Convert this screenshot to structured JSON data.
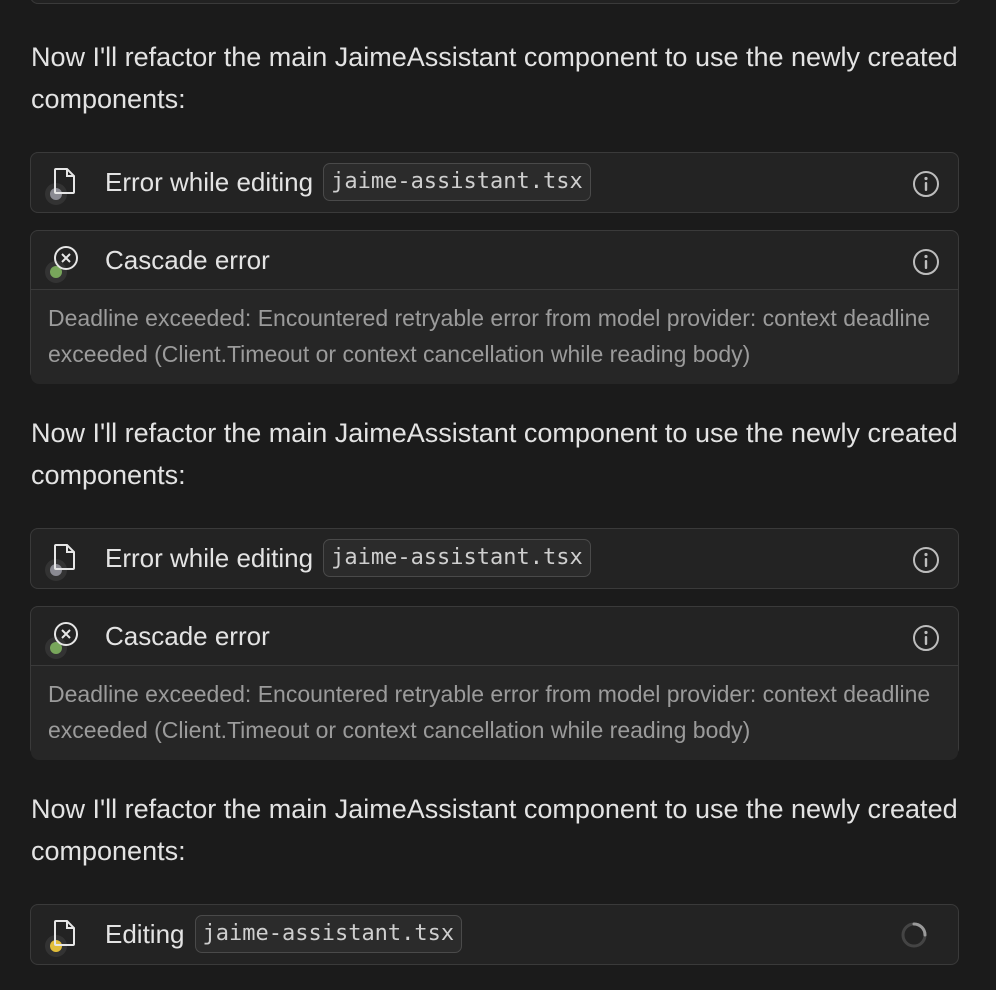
{
  "blocks": [
    {
      "message": "Now I'll refactor the main JaimeAssistant component to use the newly created components:",
      "edit_label": "Error while editing",
      "edit_file": "jaime-assistant.tsx",
      "error_title": "Cascade error",
      "error_detail": "Deadline exceeded: Encountered retryable error from model provider: context deadline exceeded (Client.Timeout or context cancellation while reading body)"
    },
    {
      "message": "Now I'll refactor the main JaimeAssistant component to use the newly created components:",
      "edit_label": "Error while editing",
      "edit_file": "jaime-assistant.tsx",
      "error_title": "Cascade error",
      "error_detail": "Deadline exceeded: Encountered retryable error from model provider: context deadline exceeded (Client.Timeout or context cancellation while reading body)"
    },
    {
      "message": "Now I'll refactor the main JaimeAssistant component to use the newly created components:",
      "edit_label": "Editing",
      "edit_file": "jaime-assistant.tsx"
    }
  ],
  "icons": {
    "file": "file-icon",
    "error": "x-circle-icon",
    "info": "info-icon",
    "spinner": "loading-spinner-icon"
  },
  "colors": {
    "background": "#1b1b1b",
    "status_gray": "#8a8a92",
    "status_green": "#78a65b",
    "status_yellow": "#e2be3a"
  }
}
